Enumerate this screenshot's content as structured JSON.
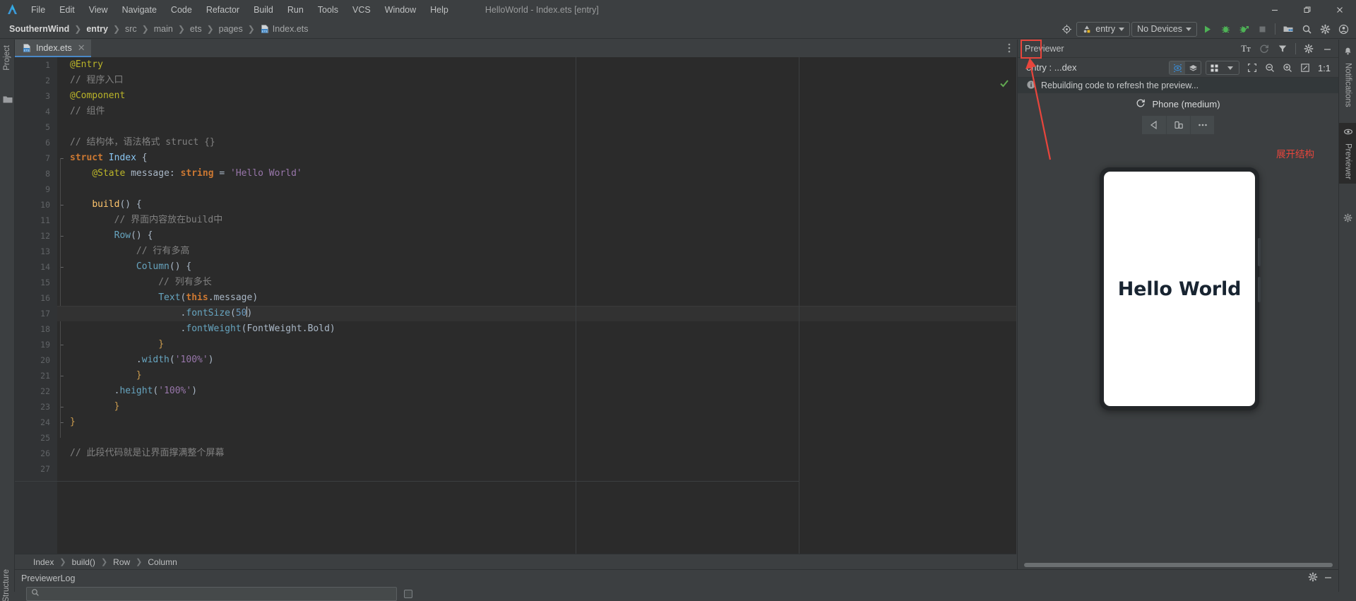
{
  "window": {
    "title": "HelloWorld - Index.ets [entry]",
    "app_icon": "deveco-logo-icon",
    "controls": {
      "minimize": "minimize-icon",
      "maximize": "maximize-icon",
      "close": "close-icon"
    }
  },
  "menubar": {
    "items": [
      "File",
      "Edit",
      "View",
      "Navigate",
      "Code",
      "Refactor",
      "Build",
      "Run",
      "Tools",
      "VCS",
      "Window",
      "Help"
    ]
  },
  "breadcrumb_top": {
    "project": "SouthernWind",
    "module": "entry",
    "path": [
      "src",
      "main",
      "ets",
      "pages"
    ],
    "file": "Index.ets"
  },
  "toolbar": {
    "search_everywhere": "target-icon",
    "run_config": "entry",
    "device": "No Devices",
    "run": "run-icon",
    "debug": "debug-icon",
    "profile": "profile-icon",
    "stop": "stop-icon",
    "project_structure": "project-structure-icon",
    "search": "search-icon",
    "settings": "gear-icon",
    "account": "account-icon"
  },
  "left_strip": {
    "project_label": "Project",
    "folder_icon": "folder-icon"
  },
  "editor": {
    "tab": {
      "label": "Index.ets",
      "icon": "ets-file-icon",
      "close": "close-icon"
    },
    "overflow": "more-options-icon",
    "inspection_status": "check-ok-icon",
    "current_line": 17,
    "lines": [
      {
        "n": 1,
        "fold": "",
        "indent": 0,
        "tokens": [
          {
            "t": "@Entry",
            "c": "t-ann"
          }
        ]
      },
      {
        "n": 2,
        "fold": "",
        "indent": 0,
        "tokens": [
          {
            "t": "// 程序入口",
            "c": "t-cm"
          }
        ]
      },
      {
        "n": 3,
        "fold": "",
        "indent": 0,
        "tokens": [
          {
            "t": "@Component",
            "c": "t-ann"
          }
        ]
      },
      {
        "n": 4,
        "fold": "",
        "indent": 0,
        "tokens": [
          {
            "t": "// 组件",
            "c": "t-cm"
          }
        ]
      },
      {
        "n": 5,
        "fold": "",
        "indent": 0,
        "tokens": []
      },
      {
        "n": 6,
        "fold": "",
        "indent": 0,
        "tokens": [
          {
            "t": "// 结构体，语法格式 struct {}",
            "c": "t-cm"
          }
        ]
      },
      {
        "n": 7,
        "fold": "-",
        "indent": 0,
        "tokens": [
          {
            "t": "struct ",
            "c": "t-kw"
          },
          {
            "t": "Index",
            "c": "t-cls"
          },
          {
            "t": " {",
            "c": "t-brace"
          }
        ]
      },
      {
        "n": 8,
        "fold": "",
        "indent": 1,
        "tokens": [
          {
            "t": "@State",
            "c": "t-ann"
          },
          {
            "t": " ",
            "c": "t-pl"
          },
          {
            "t": "message",
            "c": "t-pl"
          },
          {
            "t": ": ",
            "c": "t-brace"
          },
          {
            "t": "string",
            "c": "t-kw"
          },
          {
            "t": " = ",
            "c": "t-brace"
          },
          {
            "t": "'Hello World'",
            "c": "t-str"
          }
        ]
      },
      {
        "n": 9,
        "fold": "",
        "indent": 0,
        "tokens": []
      },
      {
        "n": 10,
        "fold": "-",
        "indent": 1,
        "tokens": [
          {
            "t": "build",
            "c": "t-fn"
          },
          {
            "t": "() {",
            "c": "t-brace"
          }
        ]
      },
      {
        "n": 11,
        "fold": "",
        "indent": 2,
        "tokens": [
          {
            "t": "// 界面内容放在build中",
            "c": "t-cm"
          }
        ]
      },
      {
        "n": 12,
        "fold": "-",
        "indent": 2,
        "tokens": [
          {
            "t": "Row",
            "c": "t-prop"
          },
          {
            "t": "() {",
            "c": "t-brace"
          }
        ]
      },
      {
        "n": 13,
        "fold": "",
        "indent": 3,
        "tokens": [
          {
            "t": "// 行有多高",
            "c": "t-cm"
          }
        ]
      },
      {
        "n": 14,
        "fold": "-",
        "indent": 3,
        "tokens": [
          {
            "t": "Column",
            "c": "t-prop"
          },
          {
            "t": "() {",
            "c": "t-brace"
          }
        ]
      },
      {
        "n": 15,
        "fold": "",
        "indent": 4,
        "tokens": [
          {
            "t": "// 列有多长",
            "c": "t-cm"
          }
        ]
      },
      {
        "n": 16,
        "fold": "",
        "indent": 4,
        "tokens": [
          {
            "t": "Text",
            "c": "t-prop"
          },
          {
            "t": "(",
            "c": "t-brace"
          },
          {
            "t": "this",
            "c": "t-kw"
          },
          {
            "t": ".message",
            "c": "t-pl"
          },
          {
            "t": ")",
            "c": "t-brace"
          }
        ]
      },
      {
        "n": 17,
        "fold": "",
        "indent": 5,
        "tokens": [
          {
            "t": ".",
            "c": "t-brace"
          },
          {
            "t": "fontSize",
            "c": "t-prop"
          },
          {
            "t": "(",
            "c": "t-brace"
          },
          {
            "t": "50",
            "c": "t-num"
          },
          {
            "t": "CARET",
            ".caret": true
          },
          {
            "t": ")",
            "c": "t-brace"
          }
        ]
      },
      {
        "n": 18,
        "fold": "",
        "indent": 5,
        "tokens": [
          {
            "t": ".",
            "c": "t-brace"
          },
          {
            "t": "fontWeight",
            "c": "t-prop"
          },
          {
            "t": "(",
            "c": "t-brace"
          },
          {
            "t": "FontWeight",
            "c": "t-pl"
          },
          {
            "t": ".Bold",
            "c": "t-pl"
          },
          {
            "t": ")",
            "c": "t-brace"
          }
        ]
      },
      {
        "n": 19,
        "fold": "+",
        "indent": 4,
        "tokens": [
          {
            "t": "}",
            "c": "t-ybr"
          }
        ]
      },
      {
        "n": 20,
        "fold": "",
        "indent": 3,
        "tokens": [
          {
            "t": ".",
            "c": "t-brace"
          },
          {
            "t": "width",
            "c": "t-prop"
          },
          {
            "t": "(",
            "c": "t-brace"
          },
          {
            "t": "'100%'",
            "c": "t-str"
          },
          {
            "t": ")",
            "c": "t-brace"
          }
        ]
      },
      {
        "n": 21,
        "fold": "+",
        "indent": 3,
        "tokens": [
          {
            "t": "}",
            "c": "t-ybr"
          }
        ]
      },
      {
        "n": 22,
        "fold": "",
        "indent": 2,
        "tokens": [
          {
            "t": ".",
            "c": "t-brace"
          },
          {
            "t": "height",
            "c": "t-prop"
          },
          {
            "t": "(",
            "c": "t-brace"
          },
          {
            "t": "'100%'",
            "c": "t-str"
          },
          {
            "t": ")",
            "c": "t-brace"
          }
        ]
      },
      {
        "n": 23,
        "fold": "+",
        "indent": 2,
        "tokens": [
          {
            "t": "}",
            "c": "t-ybr"
          }
        ]
      },
      {
        "n": 24,
        "fold": "+",
        "indent": 0,
        "tokens": [
          {
            "t": "}",
            "c": "t-ybr"
          }
        ]
      },
      {
        "n": 25,
        "fold": "",
        "indent": 0,
        "tokens": []
      },
      {
        "n": 26,
        "fold": "",
        "indent": 0,
        "tokens": [
          {
            "t": "// 此段代码就是让界面撑满整个屏幕",
            "c": "t-cm"
          }
        ]
      },
      {
        "n": 27,
        "fold": "",
        "indent": 0,
        "tokens": []
      }
    ]
  },
  "editor_breadcrumb": {
    "items": [
      "Index",
      "build()",
      "Row",
      "Column"
    ],
    "separator": "›"
  },
  "previewer": {
    "title": "Previewer",
    "header_buttons": [
      "text-size-icon",
      "refresh-icon",
      "filter-icon",
      "gear-icon",
      "minimize-icon"
    ],
    "text_size_label": "Tт",
    "target": "entry : ...dex",
    "toolbar_buttons": [
      "inspector-icon",
      "layers-icon",
      "grid-icon",
      "chevron-down-icon",
      "select-region-icon",
      "zoom-out-icon",
      "zoom-in-icon",
      "fit-screen-icon",
      "1:1"
    ],
    "zoom_ratio": "1:1",
    "status": "Rebuilding code to refresh the preview...",
    "status_icon": "info-icon",
    "device_name": "Phone (medium)",
    "device_refresh_icon": "refresh-icon",
    "device_controls": [
      "rotate-icon",
      "multi-device-icon",
      "more-icon"
    ],
    "screen_text": "Hello World"
  },
  "annotation": {
    "text": "展开结构",
    "color": "#e8453c"
  },
  "right_strip": {
    "notifications": {
      "label": "Notifications",
      "icon": "bell-icon"
    },
    "previewer": {
      "label": "Previewer",
      "icon": "eye-icon"
    }
  },
  "bottom": {
    "structure_label": "Structure",
    "log_title": "PreviewerLog",
    "log_buttons": [
      "gear-icon",
      "minimize-icon"
    ],
    "search_placeholder": "",
    "search_icon": "search-icon"
  },
  "colors": {
    "accent": "#4a88c7",
    "annotation_red": "#e8453c",
    "editor_bg": "#2b2b2b",
    "chrome_bg": "#3c3f41",
    "run_green": "#4eb256"
  }
}
